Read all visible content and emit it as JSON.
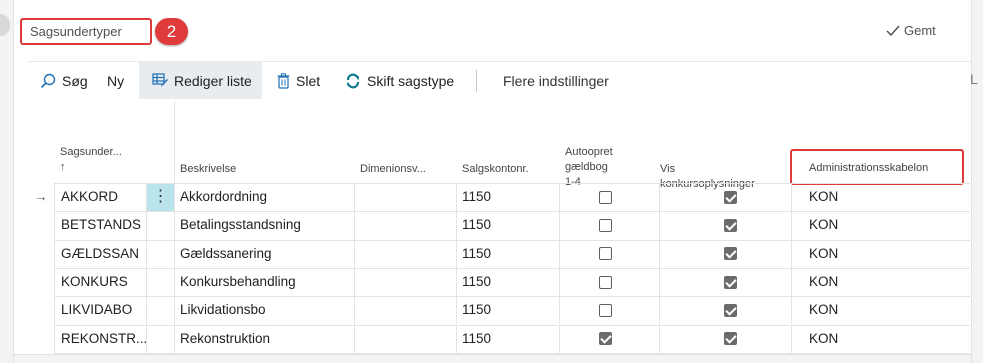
{
  "header": {
    "title": "Sagsundertyper",
    "badge": "2",
    "saved_label": "Gemt"
  },
  "toolbar": {
    "search_label": "Søg",
    "new_label": "Ny",
    "edit_list_label": "Rediger liste",
    "delete_label": "Slet",
    "switch_type_label": "Skift sagstype",
    "more_settings_label": "Flere indstillinger",
    "cut_label": "L"
  },
  "columns": {
    "sub": "Sagsunder...",
    "sub_sort": "↑",
    "desc": "Beskrivelse",
    "dim": "Dimenionsv...",
    "account": "Salgskontonr.",
    "autocreate_1": "Autoopret",
    "autocreate_2": "gældbog 1-4",
    "vis": "Vis konkursoplysninger",
    "admin": "Administrationsskabelon"
  },
  "row_marker": "→",
  "row_menu": "⋮",
  "rows": [
    {
      "code": "AKKORD",
      "desc": "Akkordordning",
      "dim": "",
      "account": "1150",
      "autocreate": false,
      "vis": true,
      "admin": "KON"
    },
    {
      "code": "BETSTANDS",
      "desc": "Betalingsstandsning",
      "dim": "",
      "account": "1150",
      "autocreate": false,
      "vis": true,
      "admin": "KON"
    },
    {
      "code": "GÆLDSSAN",
      "desc": "Gældssanering",
      "dim": "",
      "account": "1150",
      "autocreate": false,
      "vis": true,
      "admin": "KON"
    },
    {
      "code": "KONKURS",
      "desc": "Konkursbehandling",
      "dim": "",
      "account": "1150",
      "autocreate": false,
      "vis": true,
      "admin": "KON"
    },
    {
      "code": "LIKVIDABO",
      "desc": "Likvidationsbo",
      "dim": "",
      "account": "1150",
      "autocreate": false,
      "vis": true,
      "admin": "KON"
    },
    {
      "code": "REKONSTR...",
      "desc": "Rekonstruktion",
      "dim": "",
      "account": "1150",
      "autocreate": true,
      "vis": true,
      "admin": "KON"
    }
  ],
  "colors": {
    "accent_red": "#e03b3b",
    "selected_cell": "#b9e4ec",
    "icon_blue": "#1f6fb5",
    "icon_teal": "#0b7a8a"
  }
}
